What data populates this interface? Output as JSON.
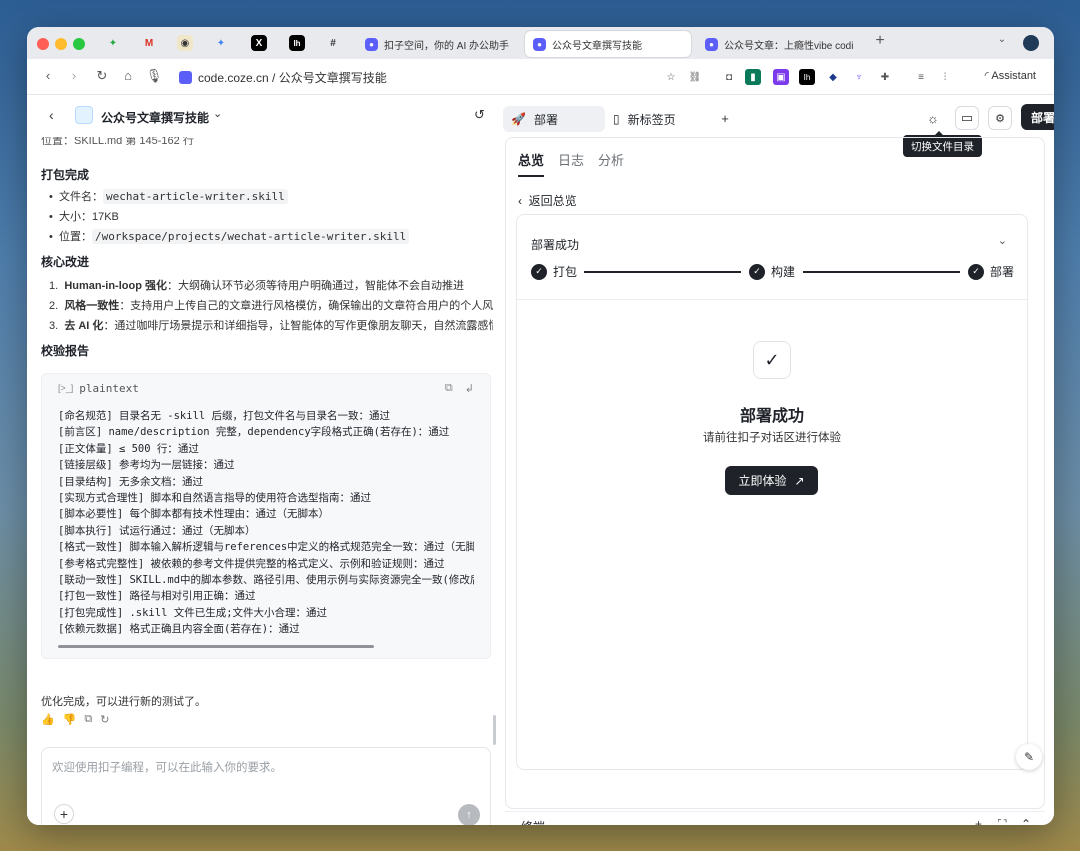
{
  "browser": {
    "tabs": [
      {
        "label": "扣子空间，你的 AI 办公助手",
        "active": false
      },
      {
        "label": "公众号文章撰写技能",
        "active": true
      },
      {
        "label": "公众号文章：上瘾性vibe codi",
        "active": false
      }
    ],
    "new_tab": "+",
    "url": "code.coze.cn / 公众号文章撰写技能",
    "assistant_label": "Assistant"
  },
  "left": {
    "project_title": "公众号文章撰写技能",
    "truncated_line": "位置：SKILL.md 第 145-162 行",
    "pack_heading": "打包完成",
    "pack_items": [
      {
        "label": "文件名：",
        "value": "wechat-article-writer.skill"
      },
      {
        "label": "大小：",
        "value": "17KB"
      },
      {
        "label": "位置：",
        "value": "/workspace/projects/wechat-article-writer.skill"
      }
    ],
    "improve_heading": "核心改进",
    "improve_items": [
      {
        "num": "1.",
        "bold": "Human-in-loop 强化",
        "text": "：大纲确认环节必须等待用户明确通过，智能体不会自动推进"
      },
      {
        "num": "2.",
        "bold": "风格一致性",
        "text": "：支持用户上传自己的文章进行风格模仿，确保输出的文章符合用户的个人风格"
      },
      {
        "num": "3.",
        "bold": "去 AI 化",
        "text": "：通过咖啡厅场景提示和详细指导，让智能体的写作更像朋友聊天，自然流露感情"
      }
    ],
    "report_heading": "校验报告",
    "code": {
      "lang": "plaintext",
      "lines": [
        "[命名规范] 目录名无 -skill 后缀，打包文件名与目录名一致：通过",
        "[前言区] name/description 完整，dependency字段格式正确(若存在)：通过",
        "[正文体量] ≤ 500 行：通过",
        "[链接层级] 参考均为一层链接：通过",
        "[目录结构] 无多余文档：通过",
        "[实现方式合理性] 脚本和自然语言指导的使用符合选型指南：通过",
        "[脚本必要性] 每个脚本都有技术性理由：通过（无脚本）",
        "[脚本执行] 试运行通过：通过（无脚本）",
        "[格式一致性] 脚本输入解析逻辑与references中定义的格式规范完全一致：通过（无脚本）",
        "[参考格式完整性] 被依赖的参考文件提供完整的格式定义、示例和验证规则：通过",
        "[联动一致性] SKILL.md中的脚本参数、路径引用、使用示例与实际资源完全一致(修改后)：通过",
        "[打包一致性] 路径与相对引用正确：通过",
        "[打包完成性] .skill 文件已生成;文件大小合理：通过",
        "[依赖元数据] 格式正确且内容全面(若存在)：通过"
      ]
    },
    "done_message": "优化完成，可以进行新的测试了。",
    "composer_placeholder": "欢迎使用扣子编程，可以在此输入你的要求。"
  },
  "right": {
    "tab_deploy": "部署",
    "tab_newtab": "新标签页",
    "add_tab": "+",
    "deploy_button": "部署",
    "tooltip": "切换文件目录",
    "subtabs": [
      "总览",
      "日志",
      "分析"
    ],
    "back_overview": "返回总览",
    "card_title": "部署成功",
    "steps": [
      "打包",
      "构建",
      "部署"
    ],
    "success_title": "部署成功",
    "success_sub": "请前往扣子对话区进行体验",
    "try_button": "立即体验",
    "terminal": "终端"
  }
}
